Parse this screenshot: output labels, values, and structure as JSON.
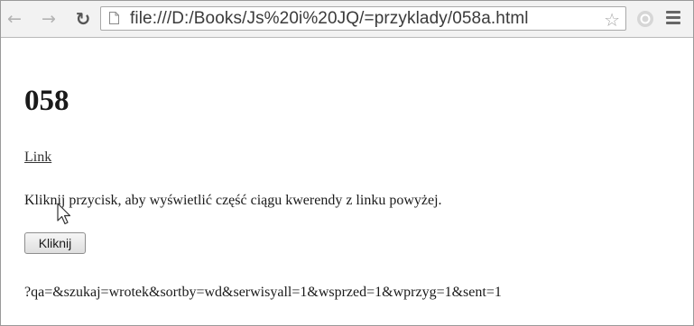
{
  "browser": {
    "back_icon": "back-arrow-icon",
    "forward_icon": "forward-arrow-icon",
    "reload_icon": "reload-icon",
    "url": "file:///D:/Books/Js%20i%20JQ/=przyklady/058a.html",
    "star_icon": "bookmark-star-icon",
    "extension_icon": "extension-icon",
    "menu_icon": "menu-icon"
  },
  "page": {
    "title": "058",
    "link_label": "Link",
    "instruction": "Kliknij przycisk, aby wyświetlić część ciągu kwerendy z linku powyżej.",
    "button_label": "Kliknij",
    "result": "?qa=&szukaj=wrotek&sortby=wd&serwisyall=1&wsprzed=1&wprzyg=1&sent=1"
  }
}
